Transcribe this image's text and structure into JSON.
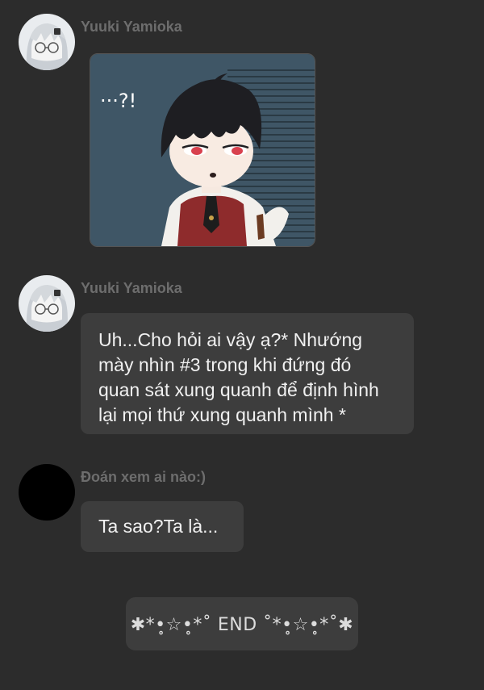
{
  "messages": [
    {
      "sender": "Yuuki Yamioka",
      "type": "image",
      "image": {
        "caption_text": "···?!"
      }
    },
    {
      "sender": "Yuuki Yamioka",
      "type": "text",
      "lines": [
        "Uh...Cho hỏi ai vậy ạ?* Nhướng",
        "mày nhìn #3 trong khi đứng đó",
        "quan sát xung quanh để định hình",
        "lại mọi thứ xung quanh mình *"
      ]
    },
    {
      "sender": "Đoán xem ai nào:)",
      "type": "text",
      "lines": [
        "Ta sao?Ta là..."
      ]
    }
  ],
  "end_marker": "✱*•̥☆•̥*˚ END ˚*•̥☆•̥*˚✱",
  "colors": {
    "background": "#2c2c2c",
    "bubble": "#3d3d3d",
    "text": "#f1f1f1",
    "sender": "#6d6d6d"
  }
}
